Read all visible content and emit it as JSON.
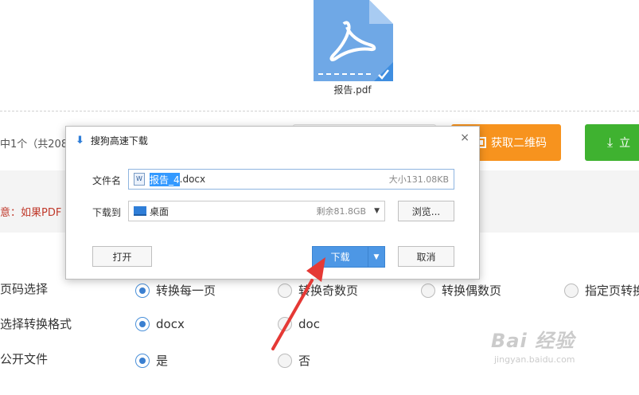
{
  "file": {
    "name": "报告.pdf"
  },
  "summary": "中1个（共208",
  "buttons": {
    "qr_label": "获取二维码",
    "green_label": "立"
  },
  "notice": "意：如果PDF",
  "options": {
    "rows": [
      {
        "label": "页码选择",
        "choices": [
          "转换每一页",
          "转换奇数页",
          "转换偶数页",
          "指定页转换"
        ]
      },
      {
        "label": "选择转换格式",
        "choices": [
          "docx",
          "doc"
        ]
      },
      {
        "label": "公开文件",
        "choices": [
          "是",
          "否"
        ]
      }
    ]
  },
  "dialog": {
    "title": "搜狗高速下载",
    "filename_label": "文件名",
    "filename_selected": "报告_4",
    "filename_rest": ".docx",
    "filesize": "大小131.08KB",
    "save_label": "下载到",
    "save_dir": "桌面",
    "free_space": "剩余81.8GB",
    "browse_label": "浏览...",
    "open_label": "打开",
    "download_label": "下载",
    "cancel_label": "取消"
  },
  "watermark": {
    "main": "Bai 经验",
    "sub": "jingyan.baidu.com"
  },
  "colors": {
    "accent": "#4d97e5",
    "orange": "#f7931e",
    "green": "#3fb230",
    "arrow": "#e53935"
  }
}
